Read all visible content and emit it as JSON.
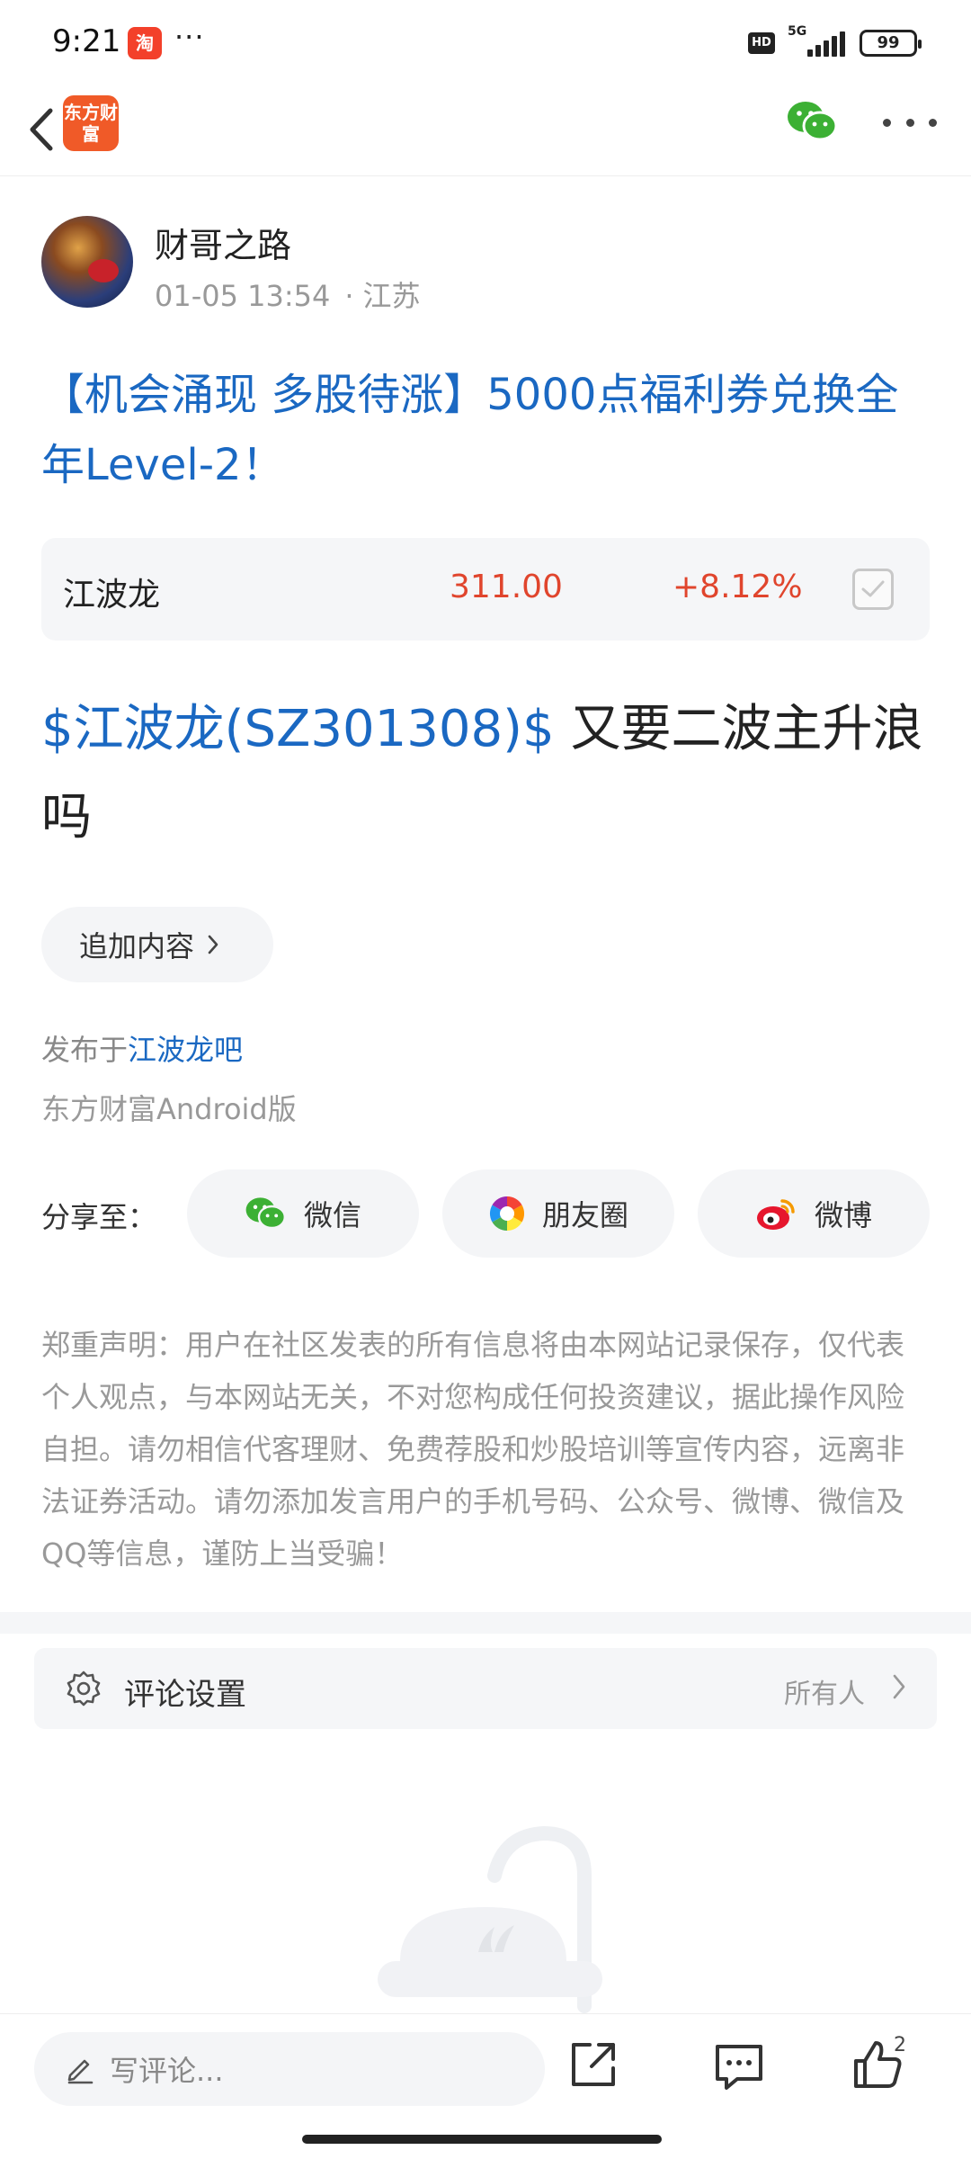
{
  "status_bar": {
    "time": "9:21",
    "app_icon_char": "淘",
    "more_dots": "···",
    "hd_label": "HD",
    "network": "5G",
    "battery": "99"
  },
  "nav": {
    "logo_text": "东方财富",
    "icons": [
      "back-arrow-icon",
      "wechat-icon",
      "more-icon"
    ]
  },
  "author": {
    "name": "财哥之路",
    "time": "01-05 13:54",
    "separator": "·",
    "location": "江苏"
  },
  "post": {
    "title": "【机会涌现 多股待涨】5000点福利券兑换全年Level-2！",
    "body_stock": "$江波龙(SZ301308)$",
    "body_text": " 又要二波主升浪吗"
  },
  "stock_card": {
    "name": "江波龙",
    "price": "311.00",
    "change": "+8.12%",
    "color_up": "#e0452d"
  },
  "actions": {
    "add_content": "追加内容",
    "published_prefix": "发布于",
    "published_bar": "江波龙吧",
    "client": "东方财富Android版"
  },
  "share": {
    "label": "分享至：",
    "wechat": "微信",
    "moments": "朋友圈",
    "weibo": "微博"
  },
  "disclaimer": "郑重声明：用户在社区发表的所有信息将由本网站记录保存，仅代表个人观点，与本网站无关，不对您构成任何投资建议，据此操作风险自担。请勿相信代客理财、免费荐股和炒股培训等宣传内容，远离非法证券活动。请勿添加发言用户的手机号码、公众号、微博、微信及QQ等信息，谨防上当受骗！",
  "comment_settings": {
    "label": "评论设置",
    "value": "所有人"
  },
  "bottom_bar": {
    "placeholder": "写评论...",
    "like_count": "2"
  },
  "colors": {
    "link_blue": "#1a68c2",
    "up_red": "#e0452d",
    "wechat_green": "#3cb034",
    "weibo_red": "#e6162d"
  }
}
